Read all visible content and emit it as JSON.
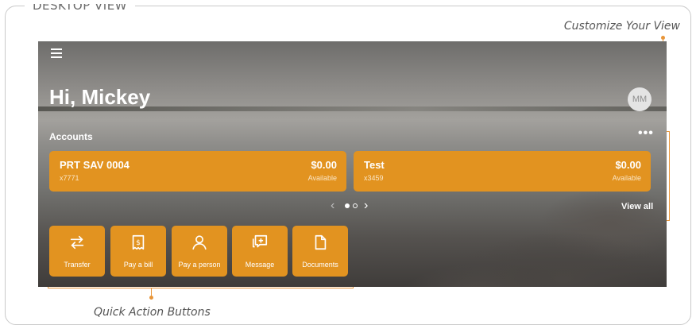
{
  "frame": {
    "title": "Desktop View",
    "callout_customize": "Customize Your View",
    "callout_quick_actions": "Quick Action Buttons"
  },
  "app": {
    "greeting": "Hi, Mickey",
    "avatar_initials": "MM",
    "accounts_label": "Accounts",
    "more_label": "•••",
    "view_all_label": "View all"
  },
  "accounts": [
    {
      "name": "PRT SAV 0004",
      "number": "x7771",
      "amount": "$0.00",
      "amount_label": "Available"
    },
    {
      "name": "Test",
      "number": "x3459",
      "amount": "$0.00",
      "amount_label": "Available"
    }
  ],
  "pager": {
    "pages": 2,
    "current": 1
  },
  "quick_actions": [
    {
      "label": "Transfer",
      "icon": "transfer-icon"
    },
    {
      "label": "Pay a bill",
      "icon": "bill-icon"
    },
    {
      "label": "Pay a person",
      "icon": "person-icon"
    },
    {
      "label": "Message",
      "icon": "message-icon"
    },
    {
      "label": "Documents",
      "icon": "document-icon"
    }
  ],
  "colors": {
    "accent": "#e29320",
    "annotation": "#e8963a"
  }
}
